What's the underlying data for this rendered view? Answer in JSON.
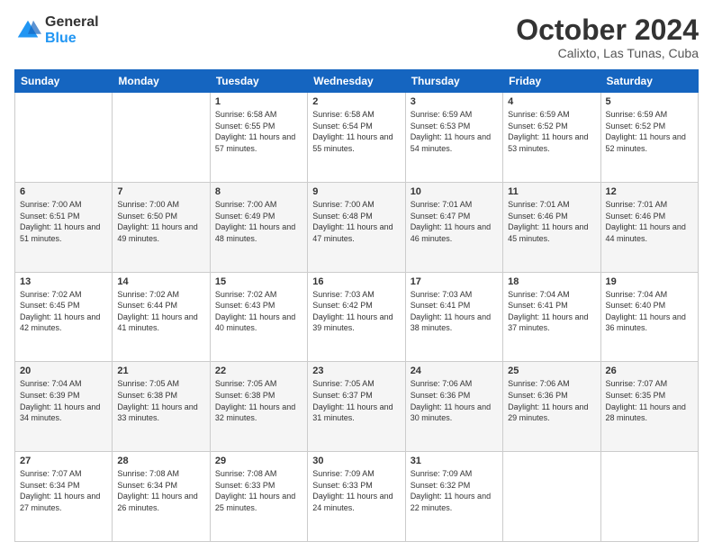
{
  "logo": {
    "general": "General",
    "blue": "Blue"
  },
  "title": "October 2024",
  "location": "Calixto, Las Tunas, Cuba",
  "days_of_week": [
    "Sunday",
    "Monday",
    "Tuesday",
    "Wednesday",
    "Thursday",
    "Friday",
    "Saturday"
  ],
  "weeks": [
    [
      null,
      null,
      {
        "day": "1",
        "sunrise": "6:58 AM",
        "sunset": "6:55 PM",
        "daylight": "11 hours and 57 minutes."
      },
      {
        "day": "2",
        "sunrise": "6:58 AM",
        "sunset": "6:54 PM",
        "daylight": "11 hours and 55 minutes."
      },
      {
        "day": "3",
        "sunrise": "6:59 AM",
        "sunset": "6:53 PM",
        "daylight": "11 hours and 54 minutes."
      },
      {
        "day": "4",
        "sunrise": "6:59 AM",
        "sunset": "6:52 PM",
        "daylight": "11 hours and 53 minutes."
      },
      {
        "day": "5",
        "sunrise": "6:59 AM",
        "sunset": "6:52 PM",
        "daylight": "11 hours and 52 minutes."
      }
    ],
    [
      {
        "day": "6",
        "sunrise": "7:00 AM",
        "sunset": "6:51 PM",
        "daylight": "11 hours and 51 minutes."
      },
      {
        "day": "7",
        "sunrise": "7:00 AM",
        "sunset": "6:50 PM",
        "daylight": "11 hours and 49 minutes."
      },
      {
        "day": "8",
        "sunrise": "7:00 AM",
        "sunset": "6:49 PM",
        "daylight": "11 hours and 48 minutes."
      },
      {
        "day": "9",
        "sunrise": "7:00 AM",
        "sunset": "6:48 PM",
        "daylight": "11 hours and 47 minutes."
      },
      {
        "day": "10",
        "sunrise": "7:01 AM",
        "sunset": "6:47 PM",
        "daylight": "11 hours and 46 minutes."
      },
      {
        "day": "11",
        "sunrise": "7:01 AM",
        "sunset": "6:46 PM",
        "daylight": "11 hours and 45 minutes."
      },
      {
        "day": "12",
        "sunrise": "7:01 AM",
        "sunset": "6:46 PM",
        "daylight": "11 hours and 44 minutes."
      }
    ],
    [
      {
        "day": "13",
        "sunrise": "7:02 AM",
        "sunset": "6:45 PM",
        "daylight": "11 hours and 42 minutes."
      },
      {
        "day": "14",
        "sunrise": "7:02 AM",
        "sunset": "6:44 PM",
        "daylight": "11 hours and 41 minutes."
      },
      {
        "day": "15",
        "sunrise": "7:02 AM",
        "sunset": "6:43 PM",
        "daylight": "11 hours and 40 minutes."
      },
      {
        "day": "16",
        "sunrise": "7:03 AM",
        "sunset": "6:42 PM",
        "daylight": "11 hours and 39 minutes."
      },
      {
        "day": "17",
        "sunrise": "7:03 AM",
        "sunset": "6:41 PM",
        "daylight": "11 hours and 38 minutes."
      },
      {
        "day": "18",
        "sunrise": "7:04 AM",
        "sunset": "6:41 PM",
        "daylight": "11 hours and 37 minutes."
      },
      {
        "day": "19",
        "sunrise": "7:04 AM",
        "sunset": "6:40 PM",
        "daylight": "11 hours and 36 minutes."
      }
    ],
    [
      {
        "day": "20",
        "sunrise": "7:04 AM",
        "sunset": "6:39 PM",
        "daylight": "11 hours and 34 minutes."
      },
      {
        "day": "21",
        "sunrise": "7:05 AM",
        "sunset": "6:38 PM",
        "daylight": "11 hours and 33 minutes."
      },
      {
        "day": "22",
        "sunrise": "7:05 AM",
        "sunset": "6:38 PM",
        "daylight": "11 hours and 32 minutes."
      },
      {
        "day": "23",
        "sunrise": "7:05 AM",
        "sunset": "6:37 PM",
        "daylight": "11 hours and 31 minutes."
      },
      {
        "day": "24",
        "sunrise": "7:06 AM",
        "sunset": "6:36 PM",
        "daylight": "11 hours and 30 minutes."
      },
      {
        "day": "25",
        "sunrise": "7:06 AM",
        "sunset": "6:36 PM",
        "daylight": "11 hours and 29 minutes."
      },
      {
        "day": "26",
        "sunrise": "7:07 AM",
        "sunset": "6:35 PM",
        "daylight": "11 hours and 28 minutes."
      }
    ],
    [
      {
        "day": "27",
        "sunrise": "7:07 AM",
        "sunset": "6:34 PM",
        "daylight": "11 hours and 27 minutes."
      },
      {
        "day": "28",
        "sunrise": "7:08 AM",
        "sunset": "6:34 PM",
        "daylight": "11 hours and 26 minutes."
      },
      {
        "day": "29",
        "sunrise": "7:08 AM",
        "sunset": "6:33 PM",
        "daylight": "11 hours and 25 minutes."
      },
      {
        "day": "30",
        "sunrise": "7:09 AM",
        "sunset": "6:33 PM",
        "daylight": "11 hours and 24 minutes."
      },
      {
        "day": "31",
        "sunrise": "7:09 AM",
        "sunset": "6:32 PM",
        "daylight": "11 hours and 22 minutes."
      },
      null,
      null
    ]
  ]
}
